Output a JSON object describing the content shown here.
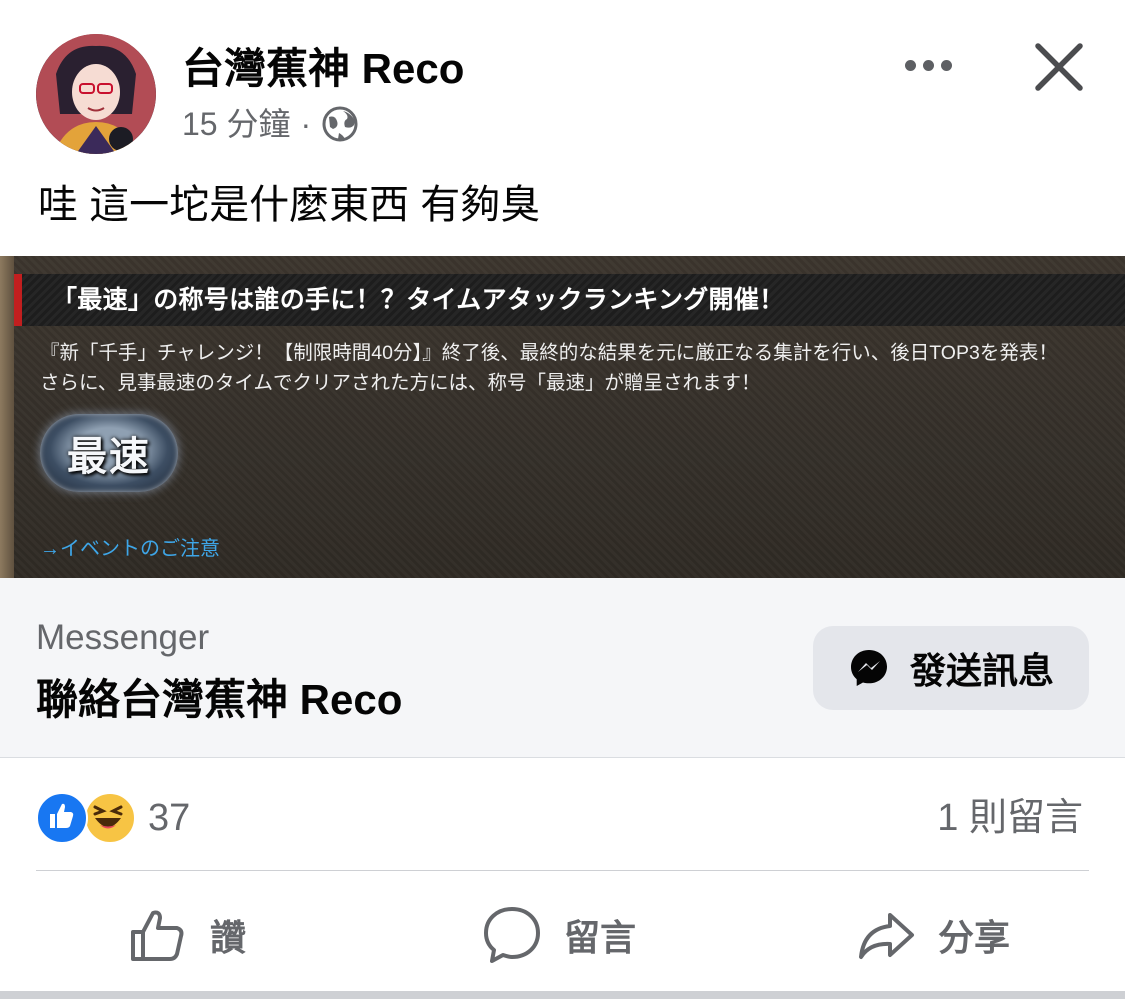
{
  "post": {
    "page_name": "台灣蕉神 Reco",
    "time": "15 分鐘",
    "separator": "·",
    "text": "哇 這一坨是什麼東西 有夠臭"
  },
  "media": {
    "banner": "「最速」の称号は誰の手に！？タイムアタックランキング開催！",
    "body_line1": "『新「千手」チャレンジ！【制限時間40分】』終了後、最終的な結果を元に厳正なる集計を行い、後日TOP3を発表！",
    "body_line2": "さらに、見事最速のタイムでクリアされた方には、称号「最速」が贈呈されます！",
    "badge": "最速",
    "link": "→イベントのご注意"
  },
  "cta": {
    "source": "Messenger",
    "title": "聯絡台灣蕉神 Reco",
    "button": "發送訊息"
  },
  "engagement": {
    "reaction_count": "37",
    "comment_count": "1 則留言"
  },
  "actions": {
    "like": "讚",
    "comment": "留言",
    "share": "分享"
  },
  "icons": {
    "more": "more-dots-icon",
    "close": "close-icon",
    "privacy": "globe-icon",
    "messenger": "messenger-icon",
    "like_reaction": "like-reaction-icon",
    "haha_reaction": "haha-reaction-icon"
  },
  "colors": {
    "like_blue": "#1877f2",
    "secondary_text": "#65676b",
    "banner_accent": "#c21f1f",
    "link_blue": "#3ea6e8"
  }
}
